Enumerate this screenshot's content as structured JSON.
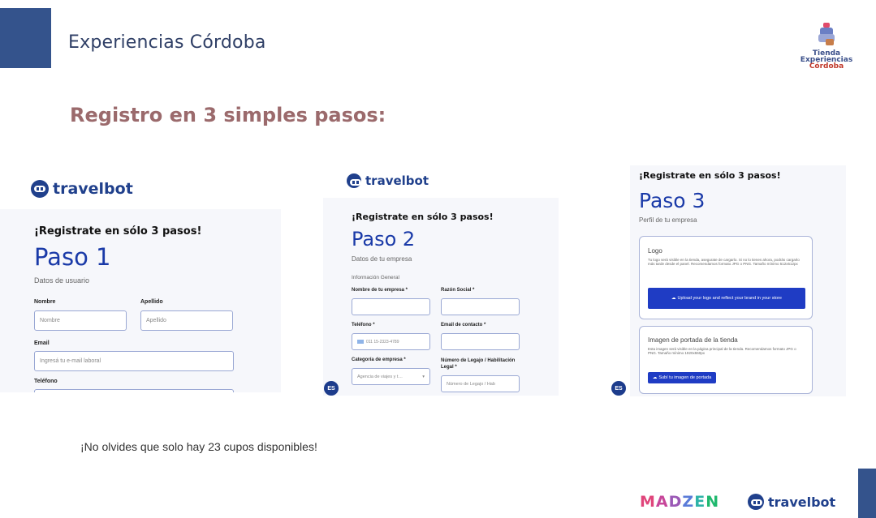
{
  "header": {
    "title": "Experiencias Córdoba"
  },
  "logo": {
    "line1": "Tienda",
    "line2": "Experiencias",
    "line3": "Córdoba"
  },
  "heading": "Registro en 3 simples pasos:",
  "brand_name": "travelbot",
  "step1": {
    "intro": "¡Registrate en sólo 3 pasos!",
    "title": "Paso 1",
    "subtitle": "Datos de usuario",
    "nombre_label": "Nombre",
    "nombre_placeholder": "Nombre",
    "apellido_label": "Apellido",
    "apellido_placeholder": "Apellido",
    "email_label": "Email",
    "email_placeholder": "Ingresá tu e-mail laboral",
    "telefono_label": "Teléfono"
  },
  "step2": {
    "intro": "¡Registrate en sólo 3 pasos!",
    "title": "Paso 2",
    "subtitle": "Datos de tu empresa",
    "section": "Información General",
    "empresa_label": "Nombre de tu empresa *",
    "razon_label": "Razón Social *",
    "telefono_label": "Teléfono *",
    "telefono_value": "011 15-2323-4789",
    "email_label": "Email de contacto *",
    "categoria_label": "Categoría de empresa *",
    "categoria_value": "Agencia de viajes y t…",
    "legajo_label": "Número de Legajo / Habilitación Legal *",
    "legajo_placeholder": "Número de Legajo / Hab",
    "lang": "ES"
  },
  "step3": {
    "intro": "¡Registrate en sólo 3 pasos!",
    "title": "Paso 3",
    "subtitle": "Perfil de tu empresa",
    "logo_title": "Logo",
    "logo_desc": "Tu logo será visible en la tienda, asegurate de cargarlo. Si no lo tienes ahora, podrás cargarlo más tarde desde el panel. Recomendamos formato JPG o PNG. Tamaño mínimo 512x512px",
    "logo_button": "Upload your logo and reflect your brand in your store",
    "cover_title": "Imagen de portada de la tienda",
    "cover_desc": "Esta imagen será visible en la página principal de la tienda. Recomendamos formato JPG o PNG. Tamaño mínimo 1920x550px",
    "cover_button": "Subí tu imagen de portada",
    "lang": "ES"
  },
  "footer": {
    "note": "¡No olvides que solo hay 23 cupos disponibles!",
    "partner_letters": [
      "M",
      "A",
      "D",
      "Z",
      "E",
      "N"
    ]
  },
  "colors": {
    "accent_blue": "#20408c",
    "heading_rose": "#9b6a6c",
    "title_blue": "#1a3aa8"
  }
}
